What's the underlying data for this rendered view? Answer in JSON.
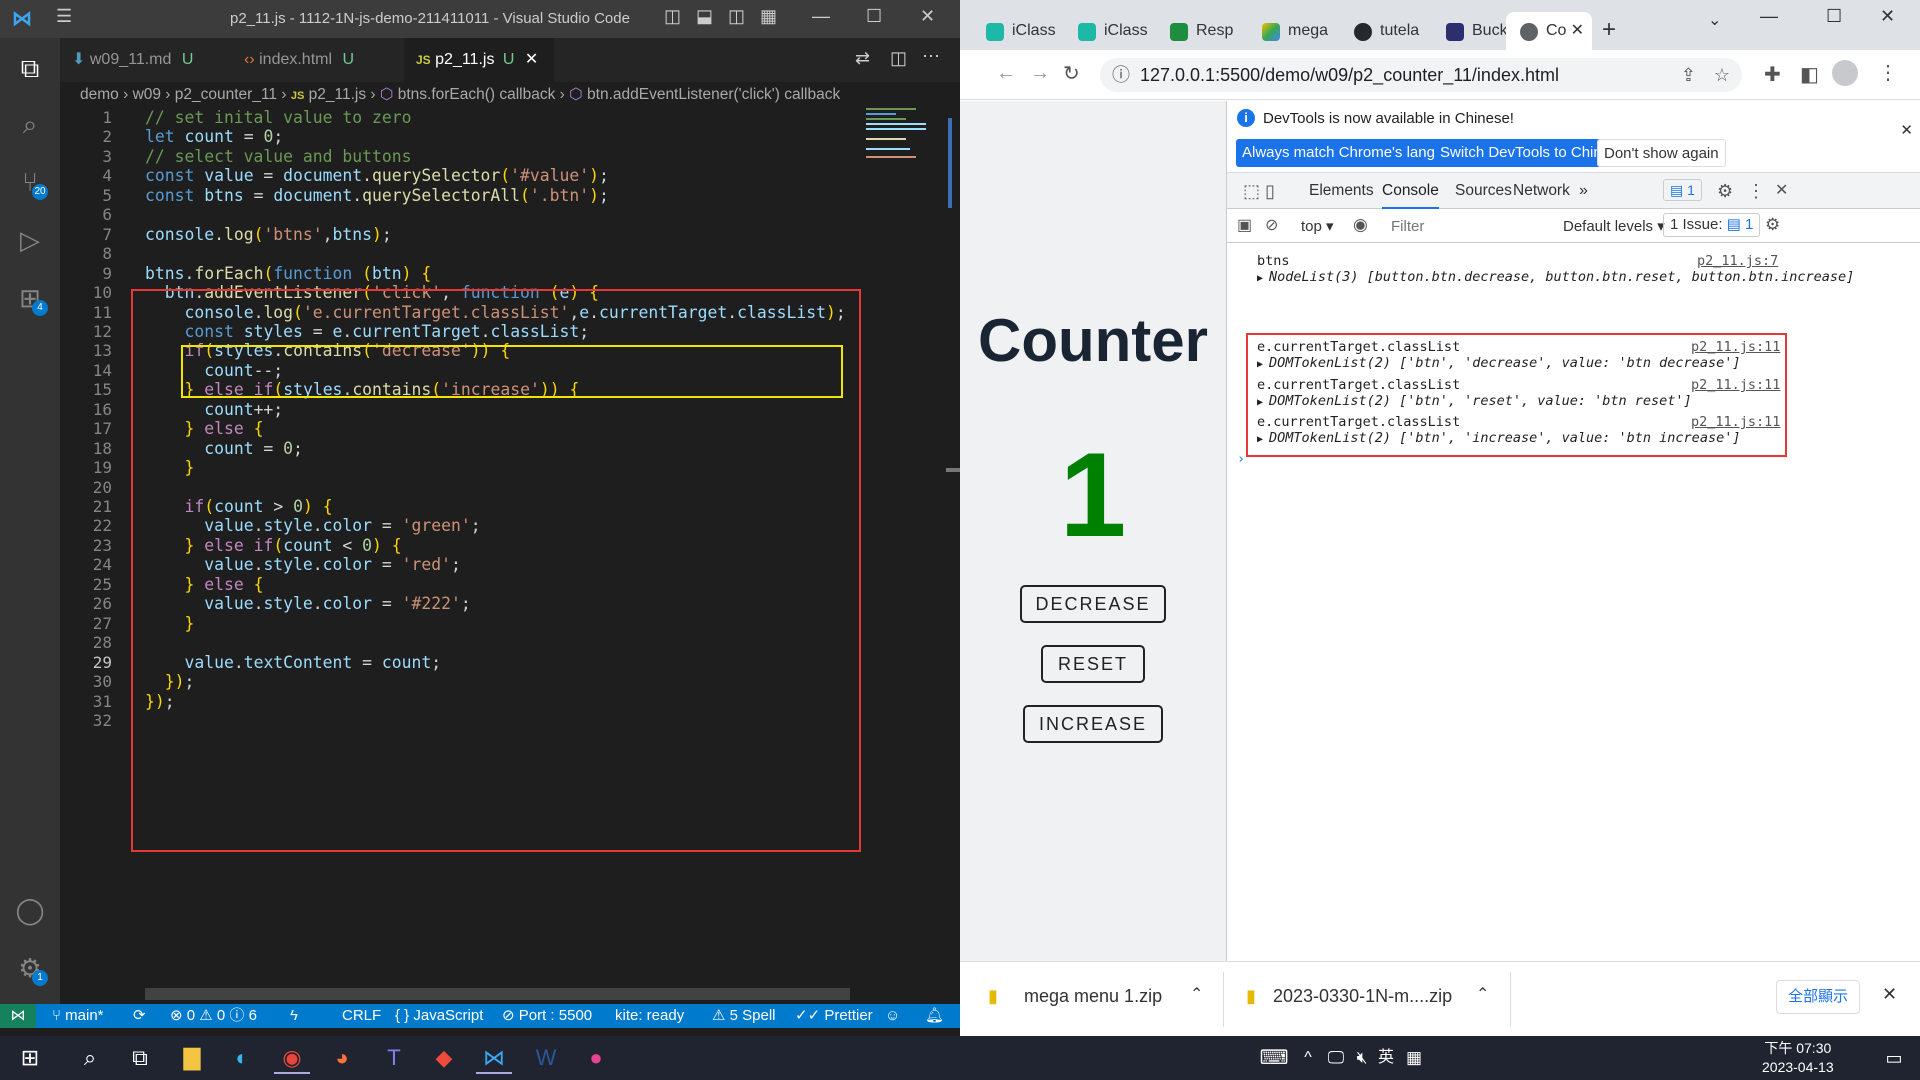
{
  "vscode": {
    "window_title": "p2_11.js - 1112-1N-js-demo-211411011 - Visual Studio Code",
    "tabs": [
      {
        "label": "w09_11.md",
        "status": "U"
      },
      {
        "label": "index.html",
        "status": "U"
      },
      {
        "label": "p2_11.js",
        "status": "U"
      }
    ],
    "breadcrumb": [
      "demo",
      "w09",
      "p2_counter_11",
      "p2_11.js",
      "btns.forEach() callback",
      "btn.addEventListener('click') callback"
    ],
    "activity_badges": {
      "source_control": "20",
      "extensions": "4",
      "settings": "1"
    },
    "line_numbers": [
      "1",
      "2",
      "3",
      "4",
      "5",
      "6",
      "7",
      "8",
      "9",
      "10",
      "11",
      "12",
      "13",
      "14",
      "15",
      "16",
      "17",
      "18",
      "19",
      "20",
      "21",
      "22",
      "23",
      "24",
      "25",
      "26",
      "27",
      "28",
      "29",
      "30",
      "31",
      "32"
    ],
    "current_line": "29",
    "code_lines": [
      "// set inital value to zero",
      "let count = 0;",
      "// select value and buttons",
      "const value = document.querySelector('#value');",
      "const btns = document.querySelectorAll('.btn');",
      "",
      "console.log('btns',btns);",
      "",
      "btns.forEach(function (btn) {",
      "  btn.addEventListener('click', function (e) {",
      "    console.log('e.currentTarget.classList',e.currentTarget.classList);",
      "    const styles = e.currentTarget.classList;",
      "    if(styles.contains('decrease')) {",
      "      count--;",
      "    } else if(styles.contains('increase')) {",
      "      count++;",
      "    } else {",
      "      count = 0;",
      "    }",
      "",
      "    if(count > 0) {",
      "      value.style.color = 'green';",
      "    } else if(count < 0) {",
      "      value.style.color = 'red';",
      "    } else {",
      "      value.style.color = '#222';",
      "    }",
      "",
      "    value.textContent = count;",
      "  });",
      "});",
      ""
    ],
    "status": {
      "branch": "main*",
      "errors": "0",
      "warnings": "0",
      "info": "6",
      "eol": "CRLF",
      "language": "JavaScript",
      "port": "Port : 5500",
      "kite": "kite: ready",
      "spell": "5 Spell",
      "prettier": "Prettier"
    }
  },
  "browser": {
    "tabs": [
      "iClass",
      "iClass",
      "Resp",
      "mega",
      "tutela",
      "Buck",
      "Co"
    ],
    "url": "127.0.0.1:5500/demo/w09/p2_counter_11/index.html",
    "page": {
      "title": "Counter",
      "value": "1",
      "value_color": "#008000",
      "buttons": [
        "DECREASE",
        "RESET",
        "INCREASE"
      ]
    },
    "devtools": {
      "info_message": "DevTools is now available in Chinese!",
      "info_buttons": [
        "Always match Chrome's language",
        "Switch DevTools to Chinese",
        "Don't show again"
      ],
      "tabs": [
        "Elements",
        "Console",
        "Sources",
        "Network"
      ],
      "active_tab": "Console",
      "message_count": "1",
      "context": "top",
      "filter_placeholder": "Filter",
      "levels": "Default levels",
      "issues": "1 Issue:",
      "issues_count": "1",
      "console_entries": [
        {
          "label": "btns",
          "value": "NodeList(3) [button.btn.decrease, button.btn.reset, button.btn.increase]",
          "source": "p2_11.js:7"
        },
        {
          "label": "e.currentTarget.classList",
          "value": "DOMTokenList(2) ['btn', 'decrease', value: 'btn decrease']",
          "source": "p2_11.js:11"
        },
        {
          "label": "e.currentTarget.classList",
          "value": "DOMTokenList(2) ['btn', 'reset', value: 'btn reset']",
          "source": "p2_11.js:11"
        },
        {
          "label": "e.currentTarget.classList",
          "value": "DOMTokenList(2) ['btn', 'increase', value: 'btn increase']",
          "source": "p2_11.js:11"
        }
      ]
    },
    "downloads": [
      {
        "name": "mega menu 1.zip"
      },
      {
        "name": "2023-0330-1N-m....zip"
      }
    ],
    "show_all_label": "全部顯示"
  },
  "taskbar": {
    "time": "下午 07:30",
    "date": "2023-04-13",
    "ime": "英"
  },
  "colors": {
    "vscode_bg": "#1e1e1e",
    "statusbar": "#007acc",
    "highlight_red": "#e53935",
    "highlight_yellow": "#f2e600",
    "devtools_blue": "#1a73e8"
  }
}
